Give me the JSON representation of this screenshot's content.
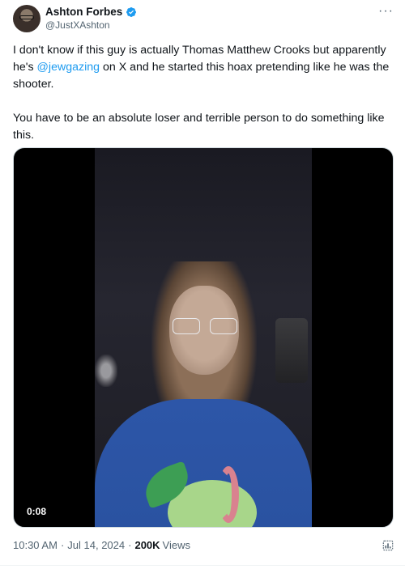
{
  "author": {
    "display_name": "Ashton Forbes",
    "handle": "@JustXAshton",
    "verified": true,
    "avatar_icon": "profile-photo"
  },
  "menu": {
    "more_label": "···"
  },
  "tweet": {
    "paragraph1_before": "I don't know if this guy is actually Thomas Matthew Crooks but apparently he's ",
    "mention": "@jewgazing",
    "paragraph1_after": " on X and he started this hoax pretending like he was the shooter.",
    "paragraph2": "You have to be an absolute loser and terrible person to do something like this."
  },
  "video": {
    "timecode": "0:08"
  },
  "meta": {
    "time": "10:30 AM",
    "date": "Jul 14, 2024",
    "views_count": "200K",
    "views_label": "Views"
  },
  "colors": {
    "accent": "#1d9bf0",
    "text": "#0f1419",
    "muted": "#536471"
  }
}
